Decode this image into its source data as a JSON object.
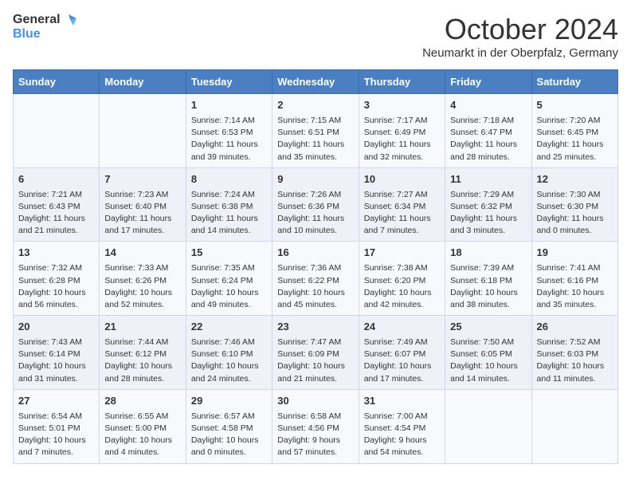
{
  "header": {
    "logo_general": "General",
    "logo_blue": "Blue",
    "title": "October 2024",
    "subtitle": "Neumarkt in der Oberpfalz, Germany"
  },
  "days_of_week": [
    "Sunday",
    "Monday",
    "Tuesday",
    "Wednesday",
    "Thursday",
    "Friday",
    "Saturday"
  ],
  "weeks": [
    [
      {
        "day": "",
        "content": ""
      },
      {
        "day": "",
        "content": ""
      },
      {
        "day": "1",
        "content": "Sunrise: 7:14 AM\nSunset: 6:53 PM\nDaylight: 11 hours and 39 minutes."
      },
      {
        "day": "2",
        "content": "Sunrise: 7:15 AM\nSunset: 6:51 PM\nDaylight: 11 hours and 35 minutes."
      },
      {
        "day": "3",
        "content": "Sunrise: 7:17 AM\nSunset: 6:49 PM\nDaylight: 11 hours and 32 minutes."
      },
      {
        "day": "4",
        "content": "Sunrise: 7:18 AM\nSunset: 6:47 PM\nDaylight: 11 hours and 28 minutes."
      },
      {
        "day": "5",
        "content": "Sunrise: 7:20 AM\nSunset: 6:45 PM\nDaylight: 11 hours and 25 minutes."
      }
    ],
    [
      {
        "day": "6",
        "content": "Sunrise: 7:21 AM\nSunset: 6:43 PM\nDaylight: 11 hours and 21 minutes."
      },
      {
        "day": "7",
        "content": "Sunrise: 7:23 AM\nSunset: 6:40 PM\nDaylight: 11 hours and 17 minutes."
      },
      {
        "day": "8",
        "content": "Sunrise: 7:24 AM\nSunset: 6:38 PM\nDaylight: 11 hours and 14 minutes."
      },
      {
        "day": "9",
        "content": "Sunrise: 7:26 AM\nSunset: 6:36 PM\nDaylight: 11 hours and 10 minutes."
      },
      {
        "day": "10",
        "content": "Sunrise: 7:27 AM\nSunset: 6:34 PM\nDaylight: 11 hours and 7 minutes."
      },
      {
        "day": "11",
        "content": "Sunrise: 7:29 AM\nSunset: 6:32 PM\nDaylight: 11 hours and 3 minutes."
      },
      {
        "day": "12",
        "content": "Sunrise: 7:30 AM\nSunset: 6:30 PM\nDaylight: 11 hours and 0 minutes."
      }
    ],
    [
      {
        "day": "13",
        "content": "Sunrise: 7:32 AM\nSunset: 6:28 PM\nDaylight: 10 hours and 56 minutes."
      },
      {
        "day": "14",
        "content": "Sunrise: 7:33 AM\nSunset: 6:26 PM\nDaylight: 10 hours and 52 minutes."
      },
      {
        "day": "15",
        "content": "Sunrise: 7:35 AM\nSunset: 6:24 PM\nDaylight: 10 hours and 49 minutes."
      },
      {
        "day": "16",
        "content": "Sunrise: 7:36 AM\nSunset: 6:22 PM\nDaylight: 10 hours and 45 minutes."
      },
      {
        "day": "17",
        "content": "Sunrise: 7:38 AM\nSunset: 6:20 PM\nDaylight: 10 hours and 42 minutes."
      },
      {
        "day": "18",
        "content": "Sunrise: 7:39 AM\nSunset: 6:18 PM\nDaylight: 10 hours and 38 minutes."
      },
      {
        "day": "19",
        "content": "Sunrise: 7:41 AM\nSunset: 6:16 PM\nDaylight: 10 hours and 35 minutes."
      }
    ],
    [
      {
        "day": "20",
        "content": "Sunrise: 7:43 AM\nSunset: 6:14 PM\nDaylight: 10 hours and 31 minutes."
      },
      {
        "day": "21",
        "content": "Sunrise: 7:44 AM\nSunset: 6:12 PM\nDaylight: 10 hours and 28 minutes."
      },
      {
        "day": "22",
        "content": "Sunrise: 7:46 AM\nSunset: 6:10 PM\nDaylight: 10 hours and 24 minutes."
      },
      {
        "day": "23",
        "content": "Sunrise: 7:47 AM\nSunset: 6:09 PM\nDaylight: 10 hours and 21 minutes."
      },
      {
        "day": "24",
        "content": "Sunrise: 7:49 AM\nSunset: 6:07 PM\nDaylight: 10 hours and 17 minutes."
      },
      {
        "day": "25",
        "content": "Sunrise: 7:50 AM\nSunset: 6:05 PM\nDaylight: 10 hours and 14 minutes."
      },
      {
        "day": "26",
        "content": "Sunrise: 7:52 AM\nSunset: 6:03 PM\nDaylight: 10 hours and 11 minutes."
      }
    ],
    [
      {
        "day": "27",
        "content": "Sunrise: 6:54 AM\nSunset: 5:01 PM\nDaylight: 10 hours and 7 minutes."
      },
      {
        "day": "28",
        "content": "Sunrise: 6:55 AM\nSunset: 5:00 PM\nDaylight: 10 hours and 4 minutes."
      },
      {
        "day": "29",
        "content": "Sunrise: 6:57 AM\nSunset: 4:58 PM\nDaylight: 10 hours and 0 minutes."
      },
      {
        "day": "30",
        "content": "Sunrise: 6:58 AM\nSunset: 4:56 PM\nDaylight: 9 hours and 57 minutes."
      },
      {
        "day": "31",
        "content": "Sunrise: 7:00 AM\nSunset: 4:54 PM\nDaylight: 9 hours and 54 minutes."
      },
      {
        "day": "",
        "content": ""
      },
      {
        "day": "",
        "content": ""
      }
    ]
  ]
}
